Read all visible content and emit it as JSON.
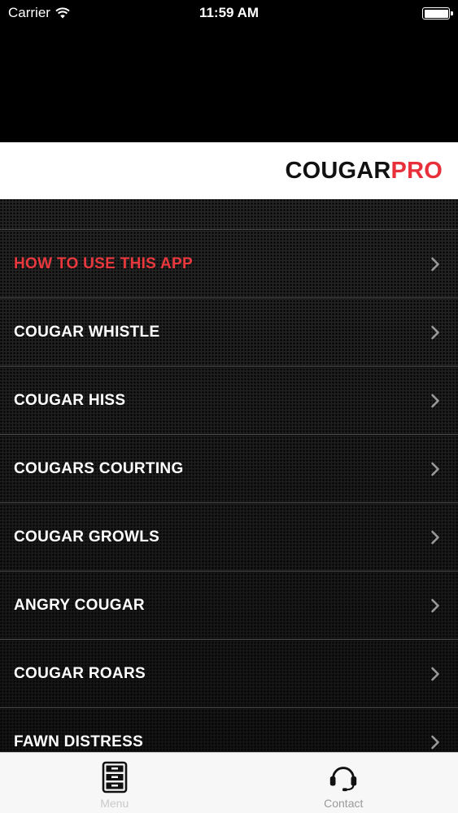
{
  "status_bar": {
    "carrier": "Carrier",
    "time": "11:59 AM"
  },
  "brand": {
    "part_a": "COUGAR",
    "part_b": "PRO",
    "color_a": "#111111",
    "color_b": "#e8303a"
  },
  "menu": {
    "items": [
      {
        "label": "HOW TO USE THIS APP",
        "active": true
      },
      {
        "label": "COUGAR WHISTLE"
      },
      {
        "label": "COUGAR HISS"
      },
      {
        "label": "COUGARS COURTING"
      },
      {
        "label": "COUGAR GROWLS"
      },
      {
        "label": "ANGRY COUGAR"
      },
      {
        "label": "COUGAR ROARS"
      },
      {
        "label": "FAWN DISTRESS"
      }
    ]
  },
  "tabbar": {
    "tabs": [
      {
        "label": "Menu",
        "icon": "file-cabinet-icon",
        "selected": true
      },
      {
        "label": "Contact",
        "icon": "headset-icon"
      }
    ]
  }
}
